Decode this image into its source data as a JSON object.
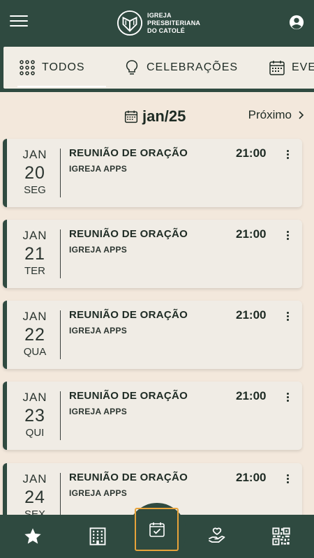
{
  "header": {
    "logo_lines": [
      "IGREJA",
      "PRESBITERIANA",
      "DO CATOLÉ"
    ],
    "menu_icon": "hamburger-menu-icon",
    "user_icon": "account-circle-icon"
  },
  "tabs": [
    {
      "label": "TODOS",
      "icon": "grid-dots-icon",
      "active": true
    },
    {
      "label": "CELEBRAÇÕES",
      "icon": "lightbulb-icon",
      "active": false
    },
    {
      "label": "EVE",
      "icon": "calendar-icon",
      "active": false
    }
  ],
  "month_nav": {
    "current": "jan/25",
    "next_label": "Próximo"
  },
  "events": [
    {
      "month": "JAN",
      "day": "20",
      "weekday": "SEG",
      "title": "REUNIÃO DE ORAÇÃO",
      "subtitle": "IGREJA APPS",
      "time": "21:00"
    },
    {
      "month": "JAN",
      "day": "21",
      "weekday": "TER",
      "title": "REUNIÃO DE ORAÇÃO",
      "subtitle": "IGREJA APPS",
      "time": "21:00"
    },
    {
      "month": "JAN",
      "day": "22",
      "weekday": "QUA",
      "title": "REUNIÃO DE ORAÇÃO",
      "subtitle": "IGREJA APPS",
      "time": "21:00"
    },
    {
      "month": "JAN",
      "day": "23",
      "weekday": "QUI",
      "title": "REUNIÃO DE ORAÇÃO",
      "subtitle": "IGREJA APPS",
      "time": "21:00"
    },
    {
      "month": "JAN",
      "day": "24",
      "weekday": "SEX",
      "title": "REUNIÃO DE ORAÇÃO",
      "subtitle": "IGREJA APPS",
      "time": "21:00"
    }
  ],
  "bottom_nav": [
    {
      "icon": "star-icon"
    },
    {
      "icon": "building-icon"
    },
    {
      "icon": "calendar-check-icon",
      "active": true
    },
    {
      "icon": "hand-heart-icon"
    },
    {
      "icon": "qr-code-icon"
    }
  ],
  "colors": {
    "primary": "#2f4a40",
    "background": "#f3e8dc",
    "card": "#f0ece5",
    "highlight": "#e8a33a"
  }
}
